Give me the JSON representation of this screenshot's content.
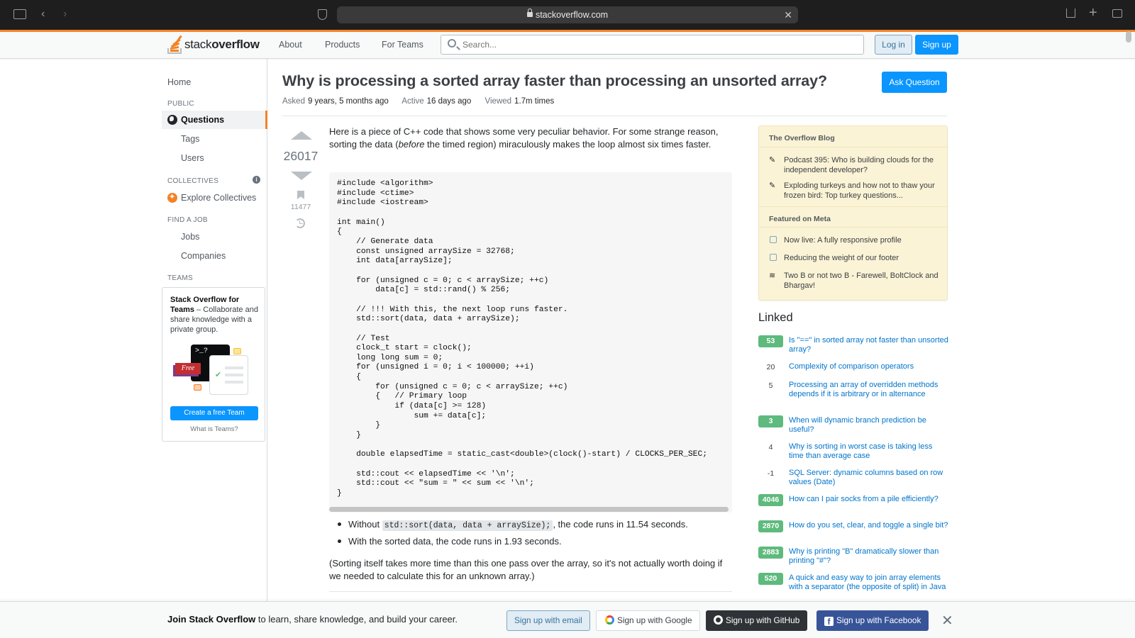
{
  "browser": {
    "url": "stackoverflow.com",
    "icons": [
      "sidebar-icon",
      "back-icon",
      "forward-icon",
      "privacy-shield-icon",
      "reader-icon",
      "close-icon",
      "share-icon",
      "new-tab-icon",
      "tabs-overview-icon"
    ]
  },
  "topbar": {
    "logo_light": "stack",
    "logo_bold": "overflow",
    "nav": [
      "About",
      "Products",
      "For Teams"
    ],
    "search_placeholder": "Search...",
    "login": "Log in",
    "signup": "Sign up"
  },
  "sidebar": {
    "home": "Home",
    "public_heading": "PUBLIC",
    "questions": "Questions",
    "tags": "Tags",
    "users": "Users",
    "collectives_heading": "COLLECTIVES",
    "explore_collectives": "Explore Collectives",
    "find_job_heading": "FIND A JOB",
    "jobs": "Jobs",
    "companies": "Companies",
    "teams_heading": "TEAMS",
    "teams_promo_bold": "Stack Overflow for Teams",
    "teams_promo_rest": " – Collaborate and share knowledge with a private group.",
    "teams_free_badge": "Free",
    "teams_terminal": ">_?",
    "teams_cta": "Create a free Team",
    "teams_what": "What is Teams?"
  },
  "question": {
    "title": "Why is processing a sorted array faster than processing an unsorted array?",
    "ask_button": "Ask Question",
    "asked_label": "Asked",
    "asked_value": "9 years, 5 months ago",
    "active_label": "Active",
    "active_value": "16 days ago",
    "viewed_label": "Viewed",
    "viewed_value": "1.7m times",
    "votes": "26017",
    "bookmarks": "11477",
    "intro_part1": "Here is a piece of C++ code that shows some very peculiar behavior. For some strange reason, sorting the data (",
    "intro_em": "before",
    "intro_part2": " the timed region) miraculously makes the loop almost six times faster.",
    "code": "#include <algorithm>\n#include <ctime>\n#include <iostream>\n\nint main()\n{\n    // Generate data\n    const unsigned arraySize = 32768;\n    int data[arraySize];\n\n    for (unsigned c = 0; c < arraySize; ++c)\n        data[c] = std::rand() % 256;\n\n    // !!! With this, the next loop runs faster.\n    std::sort(data, data + arraySize);\n\n    // Test\n    clock_t start = clock();\n    long long sum = 0;\n    for (unsigned i = 0; i < 100000; ++i)\n    {\n        for (unsigned c = 0; c < arraySize; ++c)\n        {   // Primary loop\n            if (data[c] >= 128)\n                sum += data[c];\n        }\n    }\n\n    double elapsedTime = static_cast<double>(clock()-start) / CLOCKS_PER_SEC;\n\n    std::cout << elapsedTime << '\\n';\n    std::cout << \"sum = \" << sum << '\\n';\n}",
    "bullet1_pre": "Without ",
    "bullet1_code": "std::sort(data, data + arraySize);",
    "bullet1_post": ", the code runs in 11.54 seconds.",
    "bullet2": "With the sorted data, the code runs in 1.93 seconds.",
    "tail": "(Sorting itself takes more time than this one pass over the array, so it's not actually worth doing if we needed to calculate this for an unknown array.)"
  },
  "overflow_blog": {
    "heading": "The Overflow Blog",
    "items": [
      "Podcast 395: Who is building clouds for the independent developer?",
      "Exploding turkeys and how not to thaw your frozen bird: Top turkey questions..."
    ]
  },
  "featured_meta": {
    "heading": "Featured on Meta",
    "items": [
      "Now live: A fully responsive profile",
      "Reducing the weight of our footer",
      "Two B or not two B - Farewell, BoltClock and Bhargav!"
    ]
  },
  "linked": {
    "heading": "Linked",
    "items": [
      {
        "score": "53",
        "accepted": true,
        "title": "Is \"==\" in sorted array not faster than unsorted array?"
      },
      {
        "score": "20",
        "accepted": false,
        "title": "Complexity of comparison operators"
      },
      {
        "score": "5",
        "accepted": false,
        "title": "Processing an array of overridden methods depends if it is arbitrary or in alternance"
      },
      {
        "score": "3",
        "accepted": true,
        "title": "When will dynamic branch prediction be useful?"
      },
      {
        "score": "4",
        "accepted": false,
        "title": "Why is sorting in worst case is taking less time than average case"
      },
      {
        "score": "-1",
        "accepted": false,
        "title": "SQL Server: dynamic columns based on row values (Date)"
      },
      {
        "score": "4046",
        "accepted": true,
        "title": "How can I pair socks from a pile efficiently?"
      },
      {
        "score": "2870",
        "accepted": true,
        "title": "How do you set, clear, and toggle a single bit?"
      },
      {
        "score": "2883",
        "accepted": true,
        "title": "Why is printing \"B\" dramatically slower than printing \"#\"?"
      },
      {
        "score": "520",
        "accepted": true,
        "title": "A quick and easy way to join array elements with a separator (the opposite of split) in Java"
      }
    ]
  },
  "banner": {
    "text_bold": "Join Stack Overflow",
    "text_rest": " to learn, share knowledge, and build your career.",
    "email": "Sign up with email",
    "google": "Sign up with Google",
    "github": "Sign up with GitHub",
    "facebook": "Sign up with Facebook"
  }
}
